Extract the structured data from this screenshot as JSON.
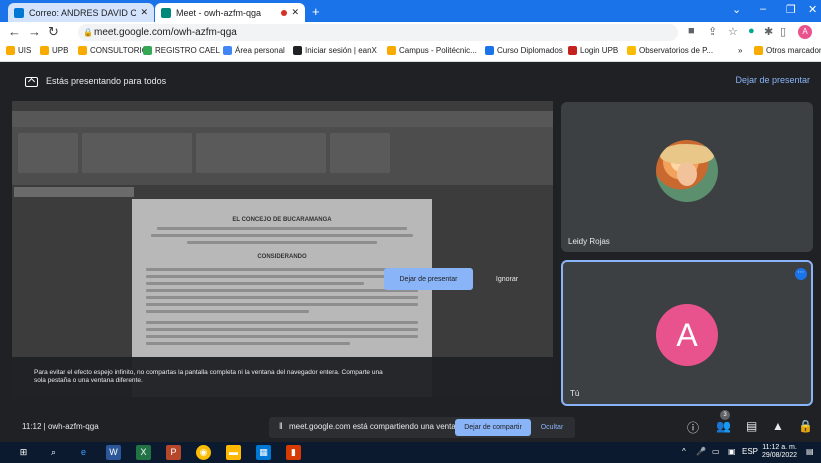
{
  "browser": {
    "tabs": [
      {
        "title": "Correo: ANDRES DAVID CAICEDO",
        "favicon_color": "#0078d4"
      },
      {
        "title": "Meet - owh-azfm-qga",
        "favicon_color": "#00897b"
      }
    ],
    "url": "meet.google.com/owh-azfm-qga",
    "profile_initial": "A"
  },
  "bookmarks": [
    {
      "label": "UIS",
      "color": "#f9ab00"
    },
    {
      "label": "UPB",
      "color": "#f9ab00"
    },
    {
      "label": "CONSULTORIO",
      "color": "#f9ab00"
    },
    {
      "label": "REGISTRO CAEL",
      "color": "#34a853"
    },
    {
      "label": "Área personal",
      "color": "#4285f4"
    },
    {
      "label": "Iniciar sesión | eanX",
      "color": "#202124"
    },
    {
      "label": "Campus - Politécnic...",
      "color": "#f9ab00"
    },
    {
      "label": "Curso Diplomados",
      "color": "#1a73e8"
    },
    {
      "label": "Login UPB",
      "color": "#c5221f"
    },
    {
      "label": "Observatorios de P...",
      "color": "#fbbc04"
    },
    {
      "label": "Otros marcadores",
      "color": "#f9ab00"
    }
  ],
  "meet": {
    "presenting_title": "Estás presentando para todos",
    "stop_presenting_link": "Dejar de presentar",
    "document": {
      "title": "EL CONCEJO DE BUCARAMANGA",
      "subtitle": "CONSIDERANDO"
    },
    "mirror_warning": "Para evitar el efecto espejo infinito, no compartas la pantalla completa ni la ventana del navegador entera. Comparte una sola pestaña o una ventana diferente.",
    "stop_presenting_button": "Dejar de presentar",
    "ignore_button": "Ignorar",
    "participants": [
      {
        "name": "Leidy Rojas"
      },
      {
        "name": "Tú",
        "initial": "A",
        "color": "#e8538d"
      }
    ],
    "meeting_info": "11:12  |  owh-azfm-qga",
    "share_notice": "meet.google.com está compartiendo una ventana.",
    "stop_sharing_button": "Dejar de compartir",
    "hide_button": "Ocultar",
    "people_count": "3"
  },
  "taskbar": {
    "language": "ESP",
    "time": "11:12 a. m.",
    "date": "29/08/2022"
  }
}
